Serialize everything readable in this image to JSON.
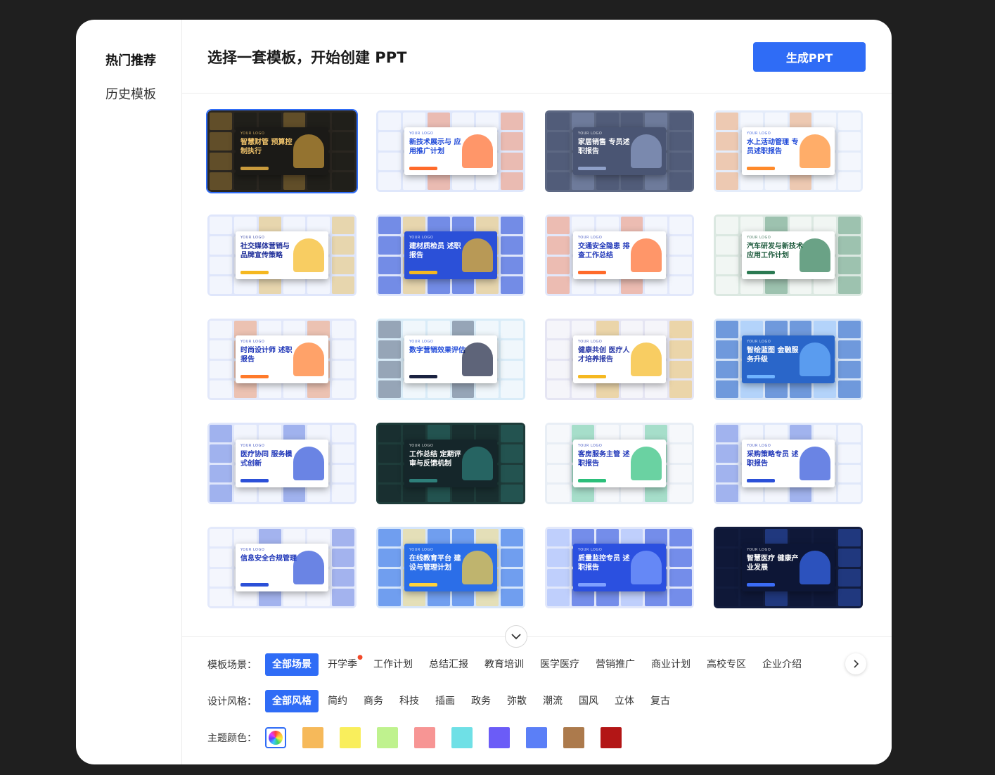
{
  "sidebar": {
    "items": [
      {
        "label": "热门推荐",
        "active": true
      },
      {
        "label": "历史模板",
        "active": false
      }
    ]
  },
  "header": {
    "title": "选择一套模板，开始创建 PPT",
    "generate_label": "生成PPT"
  },
  "templates": [
    {
      "title": "智慧财管 预算控制执行",
      "logo": "YOUR LOGO",
      "bg": "#2a2620",
      "cover": "#1b1a17",
      "text": "#f0c36b",
      "accent": "#c89a3c",
      "selected": true
    },
    {
      "title": "新技术展示与 应用推广计划",
      "logo": "YOUR LOGO",
      "bg": "#dfe7fb",
      "cover": "#ffffff",
      "text": "#1f49d8",
      "accent": "#ff6a2a",
      "selected": false
    },
    {
      "title": "家居销售 专员述职报告",
      "logo": "YOUR LOGO",
      "bg": "#5d6883",
      "cover": "#4a5573",
      "text": "#ffffff",
      "accent": "#8fa0c8",
      "selected": false
    },
    {
      "title": "水上活动管理 专员述职报告",
      "logo": "YOUR LOGO",
      "bg": "#e4ecfa",
      "cover": "#ffffff",
      "text": "#1f49d8",
      "accent": "#ff8a2a",
      "selected": false
    },
    {
      "title": "社交媒体营销与 品牌宣传策略",
      "logo": "YOUR LOGO",
      "bg": "#dfe6fb",
      "cover": "#ffffff",
      "text": "#1f2f9a",
      "accent": "#f5b820",
      "selected": false
    },
    {
      "title": "建材质检员 述职报告",
      "logo": "YOUR LOGO",
      "bg": "#dfe6fb",
      "cover": "#2b50d8",
      "text": "#ffffff",
      "accent": "#f5b820",
      "selected": false
    },
    {
      "title": "交通安全隐患 排查工作总结",
      "logo": "YOUR LOGO",
      "bg": "#e2e8fb",
      "cover": "#ffffff",
      "text": "#1f36b8",
      "accent": "#ff6a2a",
      "selected": false
    },
    {
      "title": "汽车研发与新技术 应用工作计划",
      "logo": "YOUR LOGO",
      "bg": "#dbe8e1",
      "cover": "#ffffff",
      "text": "#1c5a3c",
      "accent": "#2b7a52",
      "selected": false
    },
    {
      "title": "时尚设计师 述职报告",
      "logo": "YOUR LOGO",
      "bg": "#e2e8fa",
      "cover": "#ffffff",
      "text": "#1f36b8",
      "accent": "#ff7a2a",
      "selected": false
    },
    {
      "title": "数字营销效果评估",
      "logo": "YOUR LOGO",
      "bg": "#d9ecf8",
      "cover": "#ffffff",
      "text": "#1f49d8",
      "accent": "#1a2240",
      "selected": false
    },
    {
      "title": "健康共创 医疗人才培养报告",
      "logo": "YOUR LOGO",
      "bg": "#e5e5f3",
      "cover": "#ffffff",
      "text": "#2a3aa8",
      "accent": "#f5b820",
      "selected": false
    },
    {
      "title": "智绘蓝图 金融服务升级",
      "logo": "YOUR LOGO",
      "bg": "#d7e5f7",
      "cover": "#2a66c9",
      "text": "#ffffff",
      "accent": "#6fb3ff",
      "selected": false
    },
    {
      "title": "医疗协同 服务模式创新",
      "logo": "YOUR LOGO",
      "bg": "#dfe6fb",
      "cover": "#ffffff",
      "text": "#1f36b8",
      "accent": "#2b50d8",
      "selected": false
    },
    {
      "title": "工作总结 定期评审与反馈机制",
      "logo": "YOUR LOGO",
      "bg": "#1e3c3a",
      "cover": "#15262a",
      "text": "#ffffff",
      "accent": "#2e7f7a",
      "selected": false
    },
    {
      "title": "客房服务主管 述职报告",
      "logo": "YOUR LOGO",
      "bg": "#e8eef5",
      "cover": "#ffffff",
      "text": "#1f36b8",
      "accent": "#2bbf7a",
      "selected": false
    },
    {
      "title": "采购策略专员 述职报告",
      "logo": "YOUR LOGO",
      "bg": "#e0e8fa",
      "cover": "#ffffff",
      "text": "#1f36b8",
      "accent": "#2b50d8",
      "selected": false
    },
    {
      "title": "信息安全合规管理",
      "logo": "YOUR LOGO",
      "bg": "#e3e9fb",
      "cover": "#ffffff",
      "text": "#1f36b8",
      "accent": "#2b50d8",
      "selected": false
    },
    {
      "title": "在线教育平台 建设与管理计划",
      "logo": "YOUR LOGO",
      "bg": "#d6e6fb",
      "cover": "#2b6ee8",
      "text": "#ffffff",
      "accent": "#ffd23b",
      "selected": false
    },
    {
      "title": "质量监控专员 述职报告",
      "logo": "YOUR LOGO",
      "bg": "#e2e8fb",
      "cover": "#2b50e0",
      "text": "#ffffff",
      "accent": "#7fa0ff",
      "selected": false
    },
    {
      "title": "智慧医疗 健康产业发展",
      "logo": "YOUR LOGO",
      "bg": "#121c3e",
      "cover": "#0d1636",
      "text": "#ffffff",
      "accent": "#3b6cf6",
      "selected": false
    }
  ],
  "partial_row_colors": [
    "#dfe6fb",
    "#dfe6fb",
    "#e2e8fb",
    "#1a2a55"
  ],
  "filters": {
    "scene": {
      "label": "模板场景：",
      "options": [
        "全部场景",
        "开学季",
        "工作计划",
        "总结汇报",
        "教育培训",
        "医学医疗",
        "营销推广",
        "商业计划",
        "高校专区",
        "企业介绍"
      ],
      "active": "全部场景",
      "hot": "开学季"
    },
    "style": {
      "label": "设计风格：",
      "options": [
        "全部风格",
        "简约",
        "商务",
        "科技",
        "插画",
        "政务",
        "弥散",
        "潮流",
        "国风",
        "立体",
        "复古"
      ],
      "active": "全部风格"
    },
    "color": {
      "label": "主题颜色：",
      "swatches": [
        "rainbow",
        "#f6b95a",
        "#f9ee5c",
        "#bff28e",
        "#f79594",
        "#6fe0e6",
        "#6b5cf7",
        "#5b7ff7",
        "#ac7a4c",
        "#b31616"
      ],
      "selected": "rainbow"
    }
  },
  "icons": {
    "collapse": "chevron-down-icon",
    "next": "chevron-right-icon",
    "hot": "fire-icon"
  }
}
